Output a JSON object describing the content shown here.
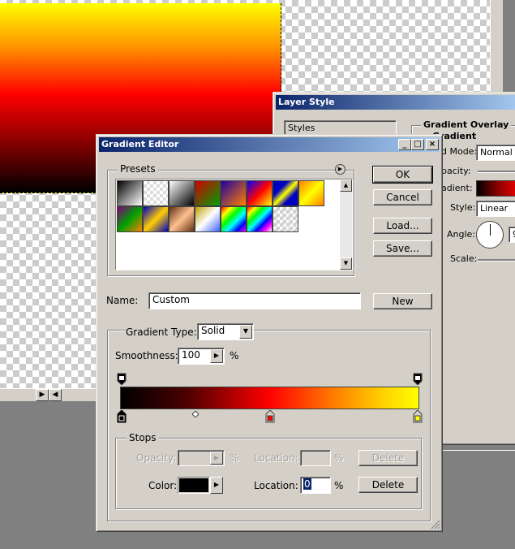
{
  "layer_style": {
    "title": "Layer Style",
    "styles_label": "Styles",
    "section_title": "Gradient Overlay",
    "sub_title": "Gradient",
    "blend_mode_label": "d Mode:",
    "blend_mode_value": "Normal",
    "opacity_label": "pacity:",
    "gradient_label": "adient:",
    "style_label": "Style:",
    "style_value": "Linear",
    "angle_label": "Angle:",
    "angle_value": "9",
    "scale_label": "Scale:"
  },
  "gradient_editor": {
    "title": "Gradient Editor",
    "presets_label": "Presets",
    "ok_label": "OK",
    "cancel_label": "Cancel",
    "load_label": "Load...",
    "save_label": "Save...",
    "name_label": "Name:",
    "name_value": "Custom",
    "new_label": "New",
    "gradient_type_label": "Gradient Type:",
    "gradient_type_value": "Solid",
    "smoothness_label": "Smoothness:",
    "smoothness_value": "100",
    "percent": "%",
    "stops": {
      "group_label": "Stops",
      "opacity_label": "Opacity:",
      "opacity_location_label": "Location:",
      "opacity_delete_label": "Delete",
      "color_label": "Color:",
      "color_location_label": "Location:",
      "color_location_value": "0",
      "color_delete_label": "Delete"
    },
    "colors": {
      "color_stop_black": "#000000",
      "color_stop_red": "#ff0000",
      "color_stop_yellow": "#ffff00"
    }
  }
}
